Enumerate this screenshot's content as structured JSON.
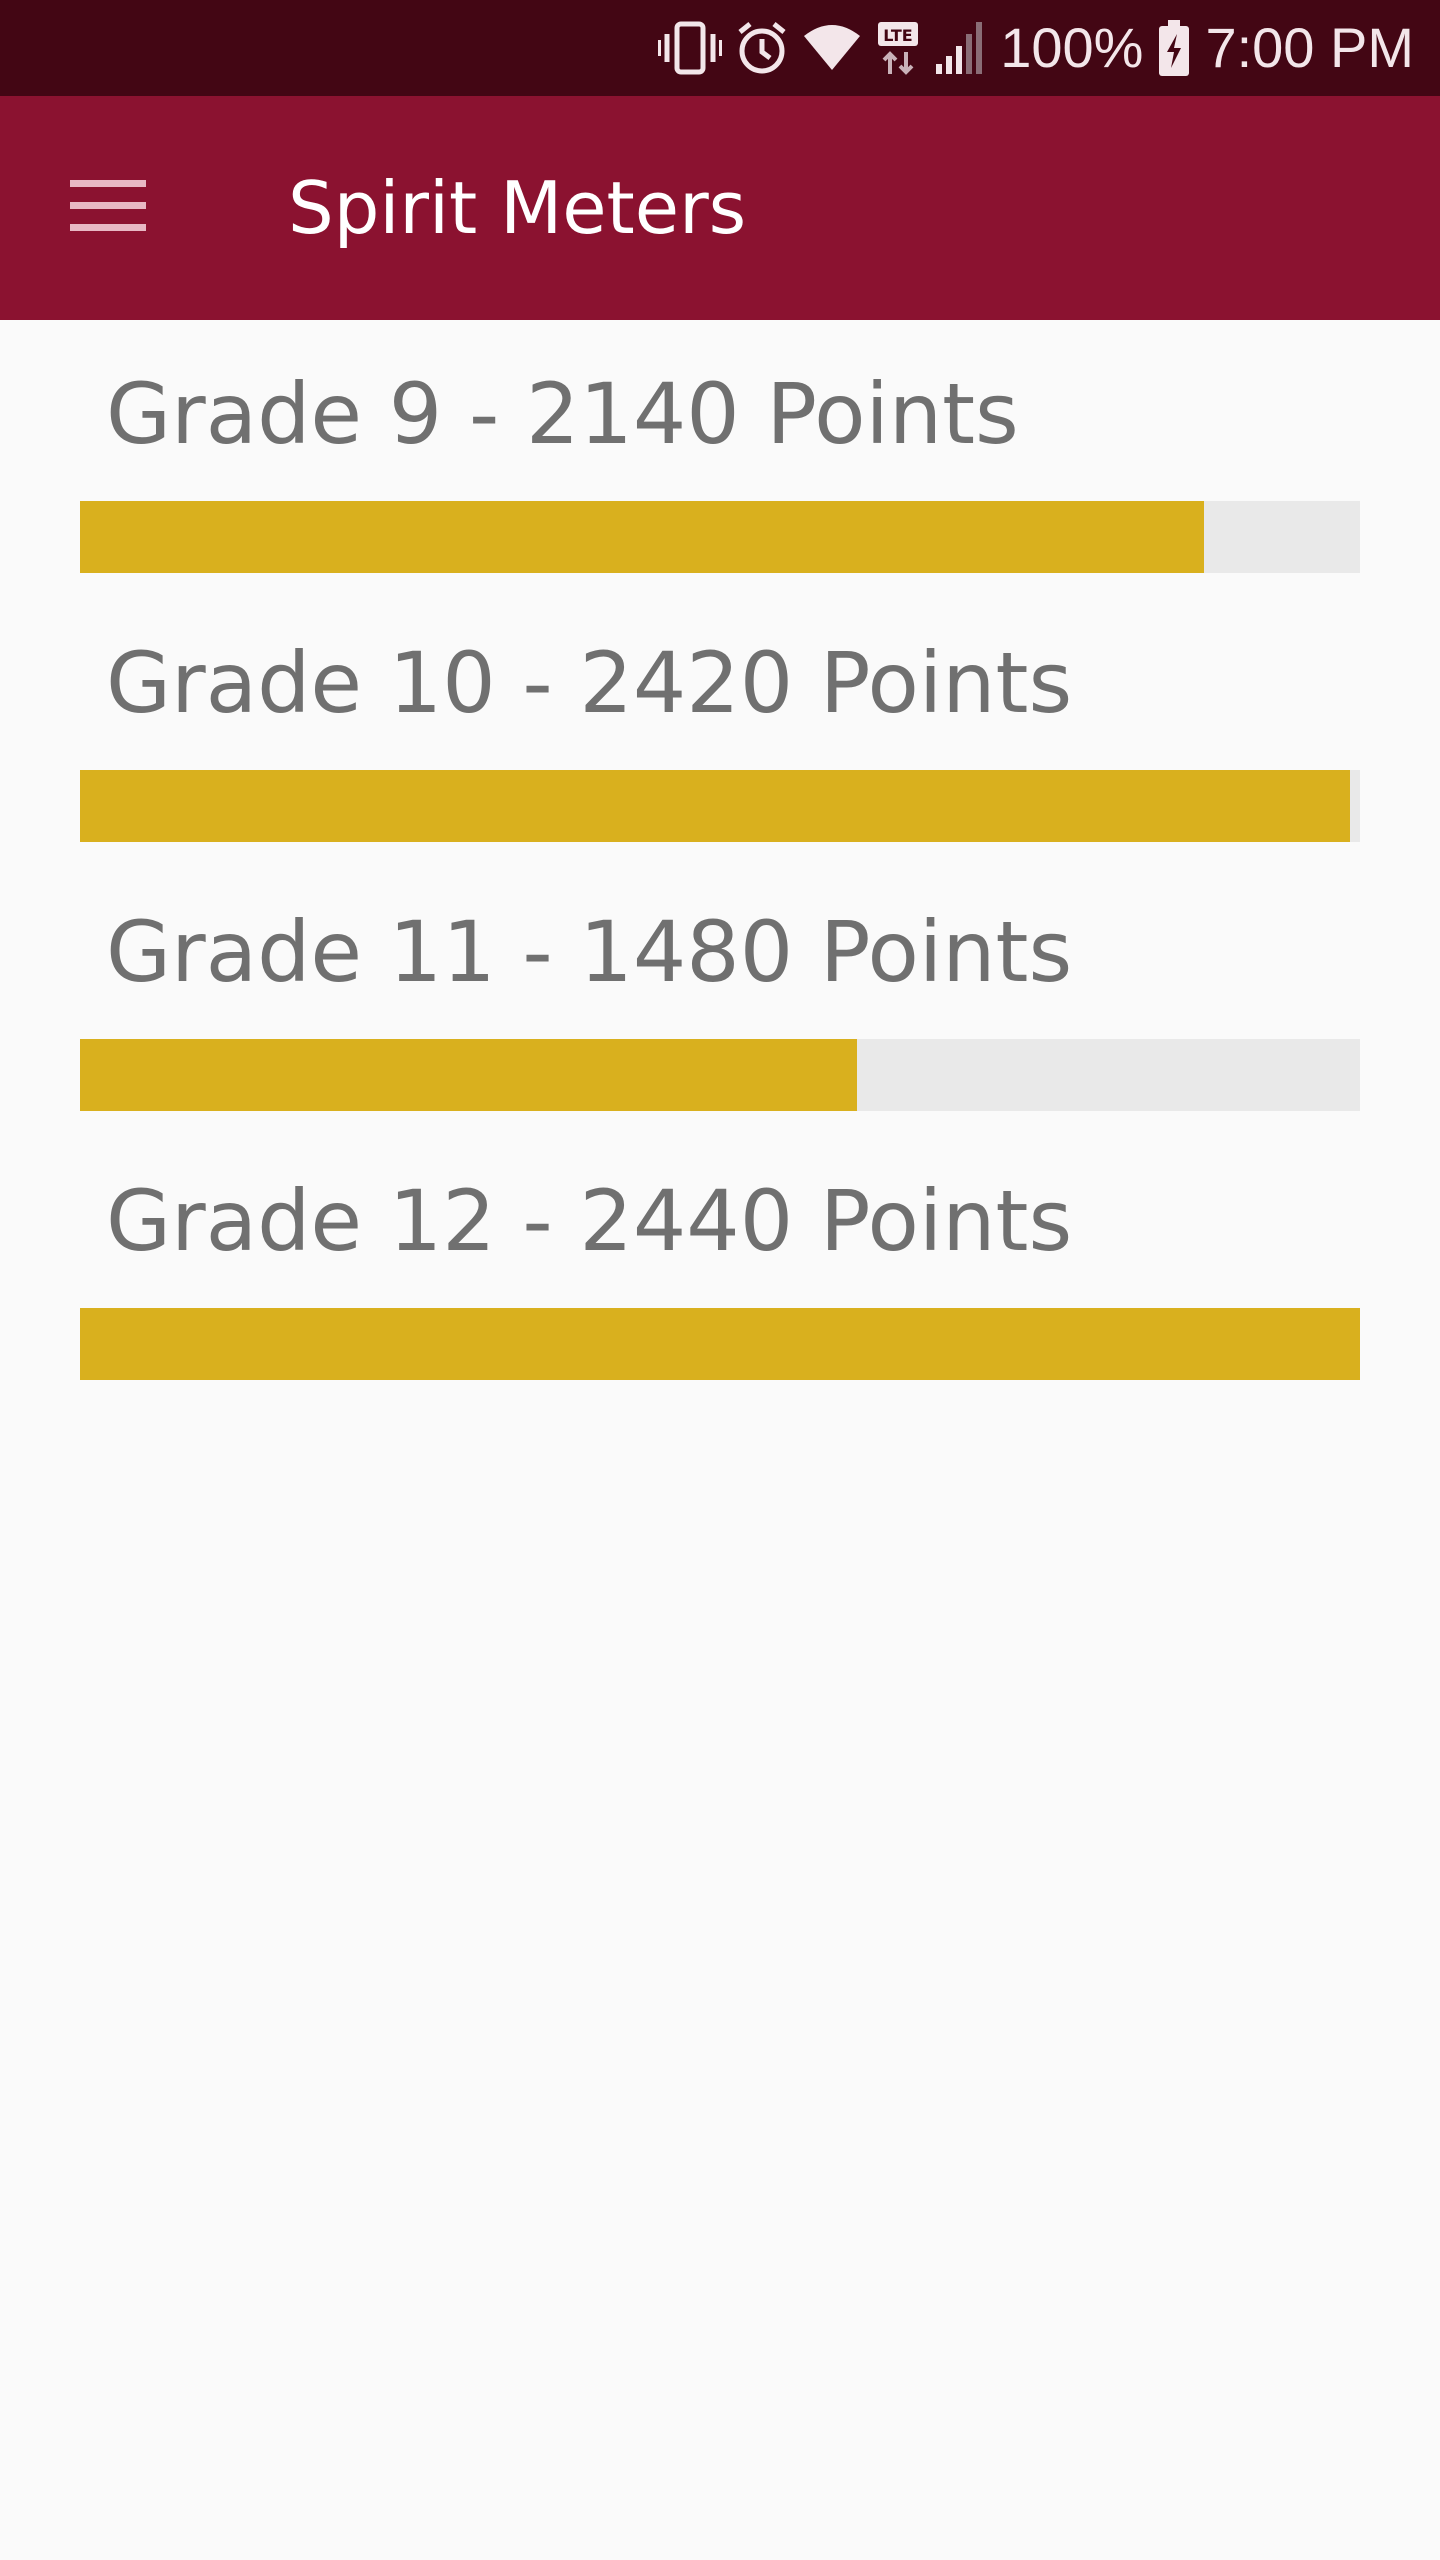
{
  "status_bar": {
    "battery_text": "100%",
    "time": "7:00 PM",
    "icons": [
      "vibrate-icon",
      "alarm-icon",
      "wifi-icon",
      "lte-icon",
      "signal-icon",
      "battery-charging-icon"
    ]
  },
  "app_bar": {
    "title": "Spirit Meters",
    "menu_icon": "menu-icon"
  },
  "meters": [
    {
      "label": "Grade 9 - 2140 Points",
      "grade": 9,
      "points": 2140,
      "progress": 0.878
    },
    {
      "label": "Grade 10 - 2420 Points",
      "grade": 10,
      "points": 2420,
      "progress": 0.992
    },
    {
      "label": "Grade 11 - 1480 Points",
      "grade": 11,
      "points": 1480,
      "progress": 0.607
    },
    {
      "label": "Grade 12 - 2440 Points",
      "grade": 12,
      "points": 2440,
      "progress": 1.0
    }
  ],
  "colors": {
    "status_bar": "#430614",
    "app_bar": "#8b1230",
    "meter_fill": "#d9b01e",
    "meter_track": "#e9e9e9",
    "label_text": "#707070",
    "background": "#fafafa"
  }
}
